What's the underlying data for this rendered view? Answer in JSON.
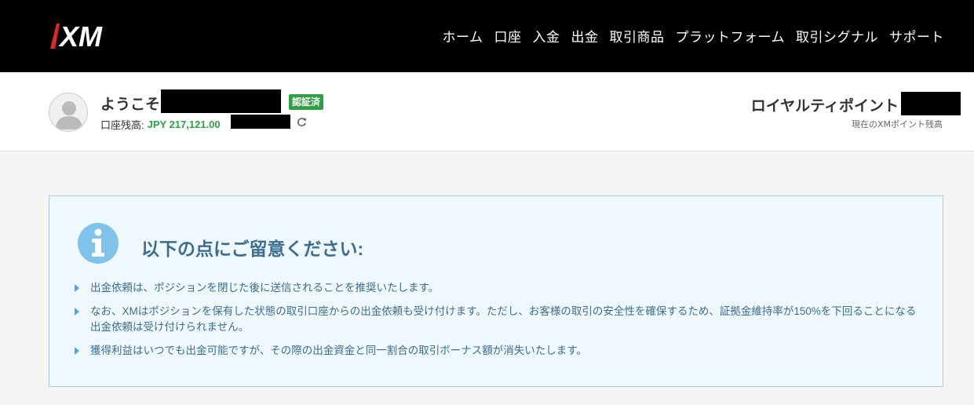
{
  "nav": {
    "logo_text": "XM",
    "items": [
      {
        "label": "ホーム"
      },
      {
        "label": "口座"
      },
      {
        "label": "入金"
      },
      {
        "label": "出金"
      },
      {
        "label": "取引商品"
      },
      {
        "label": "プラットフォーム"
      },
      {
        "label": "取引シグナル"
      },
      {
        "label": "サポート"
      }
    ]
  },
  "account": {
    "welcome": "ようこそ",
    "verified_badge": "認証済",
    "balance_label": "口座残高:",
    "balance_value": "JPY 217,121.00",
    "loyalty_title": "ロイヤルティポイント",
    "loyalty_subtitle": "現在のXMポイント残高"
  },
  "notice": {
    "title": "以下の点にご留意ください:",
    "items": [
      "出金依頼は、ポジションを閉じた後に送信されることを推奨いたします。",
      "なお、XMはポジションを保有した状態の取引口座からの出金依頼も受け付けます。ただし、お客様の取引の安全性を確保するため、証拠金維持率が150%を下回ることになる出金依頼は受け付けられません。",
      "獲得利益はいつでも出金可能ですが、その際の出金資金と同一割合の取引ボーナス額が消失いたします。"
    ]
  },
  "colors": {
    "nav_bg": "#000000",
    "verified_green": "#2ea043",
    "notice_bg": "#eef8fd",
    "notice_text": "#3d6e90",
    "info_icon": "#7fc3ea"
  }
}
